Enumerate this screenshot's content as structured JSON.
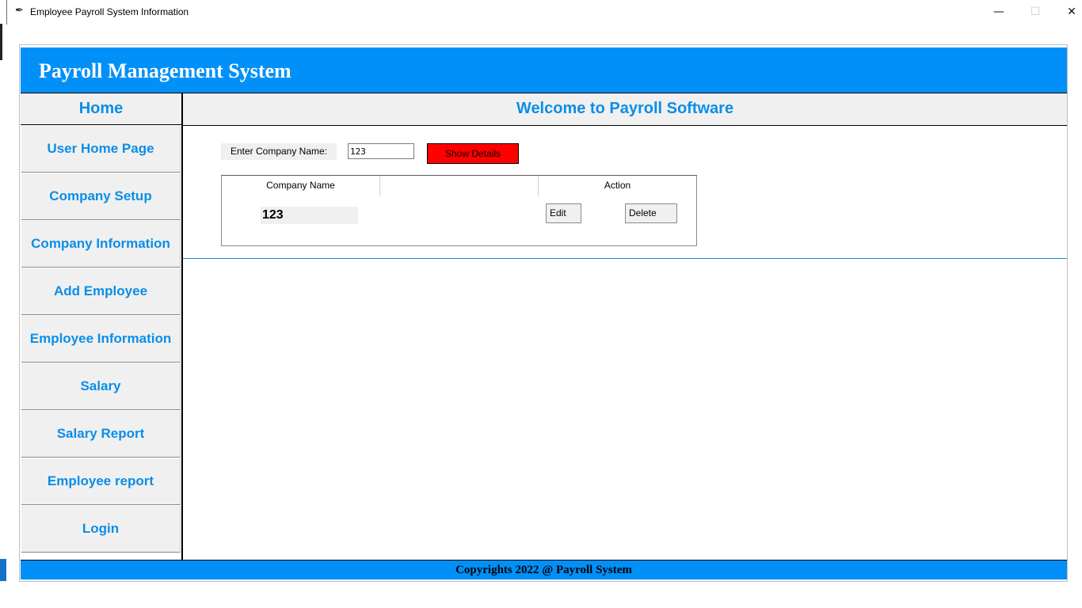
{
  "window": {
    "title": "Employee Payroll System Information",
    "minimize_glyph": "—",
    "maximize_glyph": "☐",
    "close_glyph": "✕",
    "icon_glyph": "✒"
  },
  "header": {
    "title": "Payroll Management System"
  },
  "sidebar": {
    "home_label": "Home",
    "items": [
      {
        "label": "User Home Page"
      },
      {
        "label": "Company Setup"
      },
      {
        "label": "Company Information"
      },
      {
        "label": "Add Employee"
      },
      {
        "label": "Employee Information"
      },
      {
        "label": "Salary"
      },
      {
        "label": "Salary Report"
      },
      {
        "label": "Employee report"
      },
      {
        "label": "Login"
      }
    ]
  },
  "main": {
    "title": "Welcome to Payroll Software",
    "search": {
      "label": "Enter Company Name:",
      "value": "123",
      "button_label": "Show Details"
    },
    "table": {
      "headers": [
        "Company Name",
        "",
        "Action"
      ],
      "rows": [
        {
          "company_name": "123",
          "edit_label": "Edit",
          "delete_label": "Delete"
        }
      ]
    }
  },
  "footer": {
    "text": "Copyrights 2022 @ Payroll System"
  },
  "colors": {
    "accent_blue": "#0090f8",
    "label_blue": "#0a8ee8",
    "show_button_red": "#ff0000",
    "panel_gray": "#f0f0f0"
  }
}
